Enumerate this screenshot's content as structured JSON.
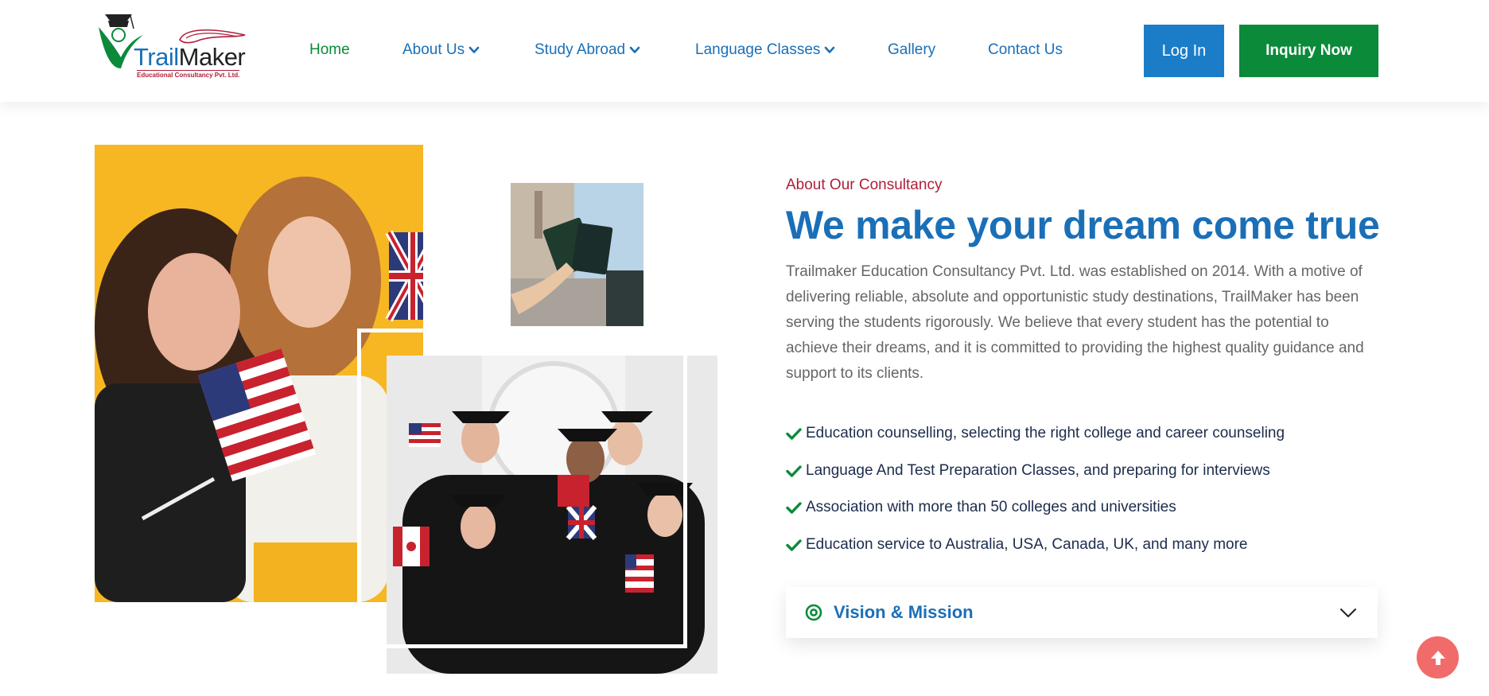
{
  "brand": {
    "name_part1": "Trail",
    "name_part2": "Maker",
    "tagline": "Educational Consultancy Pvt. Ltd."
  },
  "nav": {
    "items": [
      {
        "label": "Home",
        "active": true,
        "dropdown": false
      },
      {
        "label": "About Us",
        "active": false,
        "dropdown": true
      },
      {
        "label": "Study Abroad",
        "active": false,
        "dropdown": true
      },
      {
        "label": "Language Classes",
        "active": false,
        "dropdown": true
      },
      {
        "label": "Gallery",
        "active": false,
        "dropdown": false
      },
      {
        "label": "Contact Us",
        "active": false,
        "dropdown": false
      }
    ],
    "login_label": "Log In",
    "inquiry_label": "Inquiry Now"
  },
  "about": {
    "eyebrow": "About Our Consultancy",
    "headline": "We make your dream come true",
    "paragraph": "Trailmaker Education Consultancy Pvt. Ltd. was established on 2014. With a motive of delivering reliable, absolute and opportunistic study destinations, TrailMaker has been serving the students rigorously. We believe that every student has the potential to achieve their dreams, and it is committed to providing the highest quality guidance and support to its clients.",
    "features": [
      "Education counselling, selecting the right college and career counseling",
      "Language And Test Preparation Classes, and preparing for interviews",
      "Association with more than 50 colleges and universities",
      "Education service to Australia, USA, Canada, UK, and many more"
    ],
    "accordion_label": "Vision & Mission"
  },
  "colors": {
    "primary_blue": "#1b6fb7",
    "brand_green": "#0b8a3a",
    "accent_red": "#b01e3a",
    "scroll_top": "#f26b6b"
  },
  "icons": {
    "feature": "check-icon",
    "accordion": "target-icon",
    "accordion_toggle": "chevron-down-icon",
    "scroll_top": "arrow-up-icon"
  }
}
